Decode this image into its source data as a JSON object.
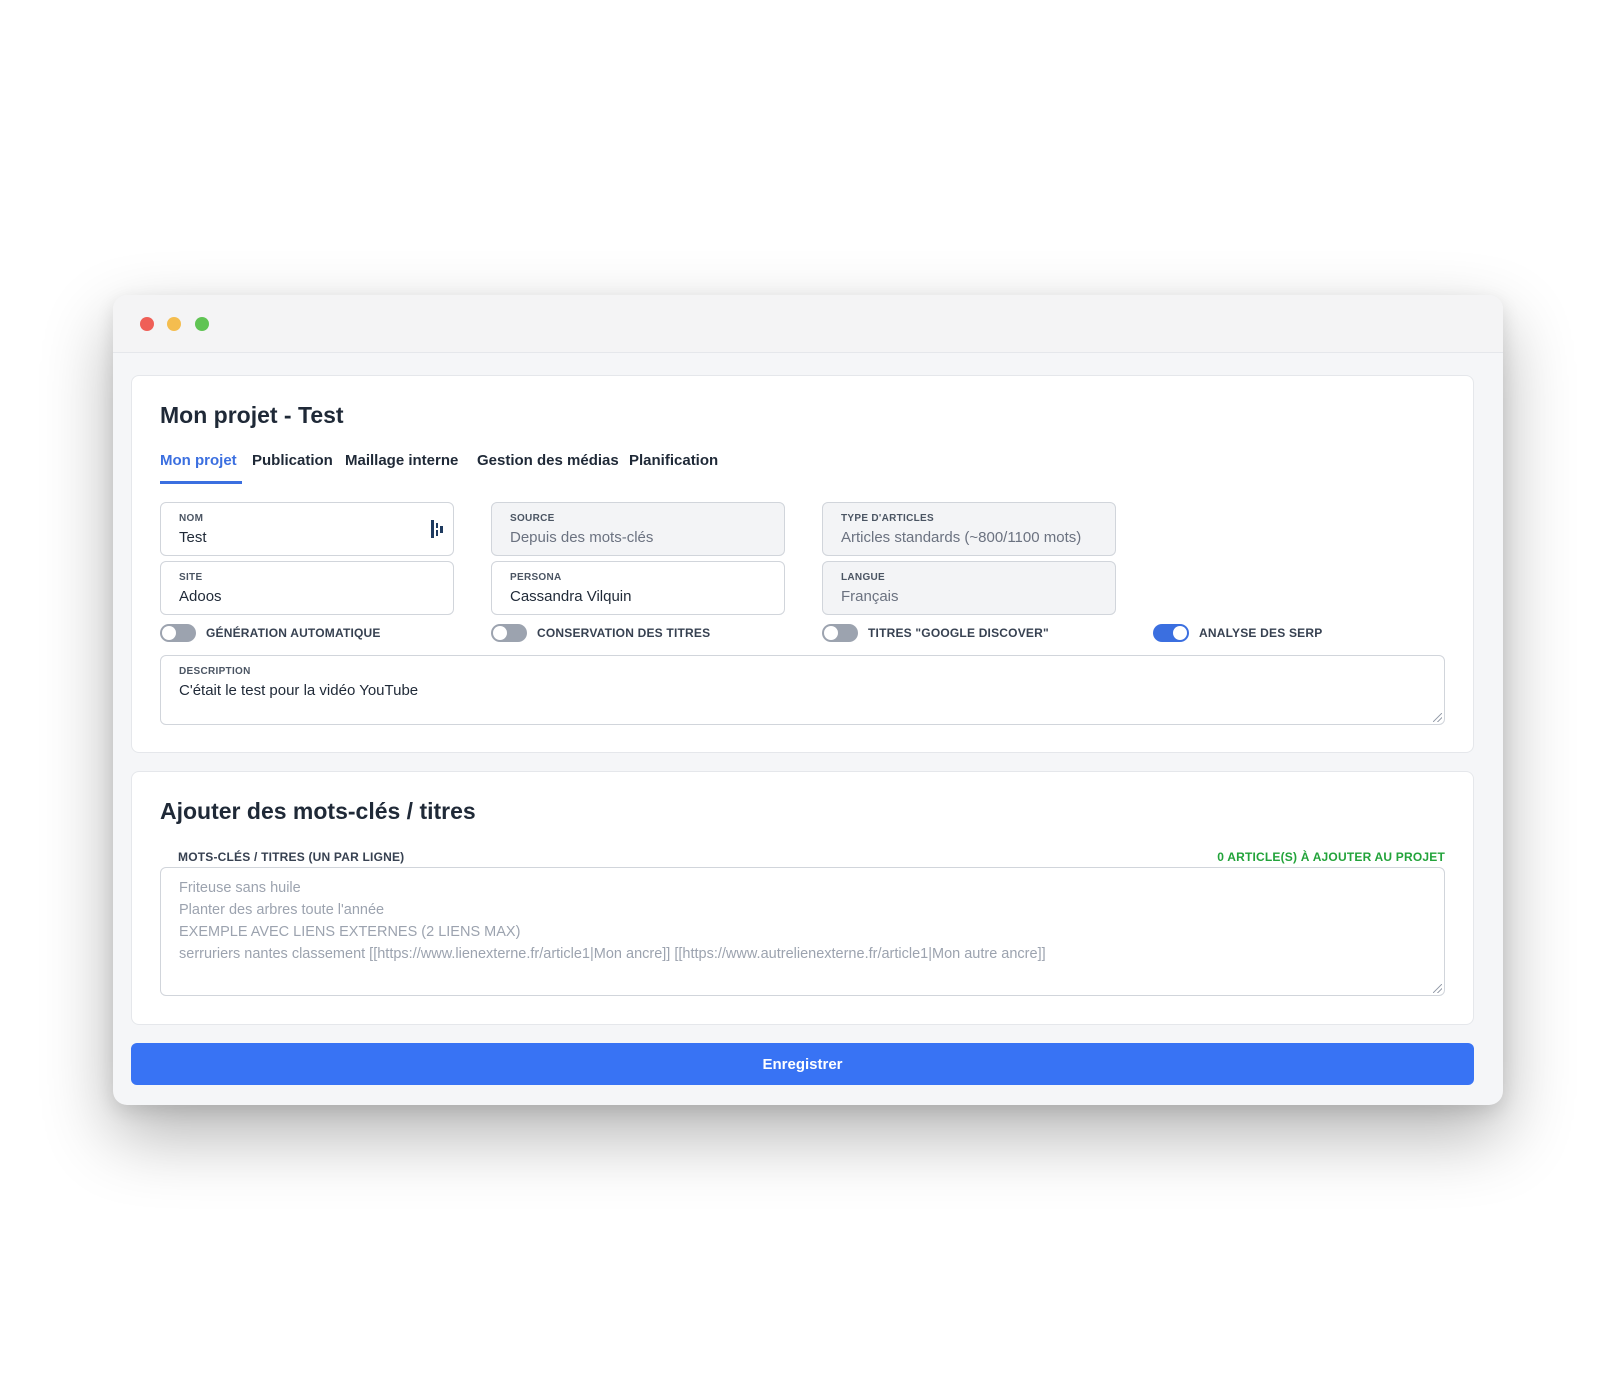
{
  "window": {
    "controls": [
      "close",
      "minimize",
      "maximize"
    ]
  },
  "project": {
    "title": "Mon projet - Test",
    "tabs": [
      {
        "label": "Mon projet",
        "active": true
      },
      {
        "label": "Publication",
        "active": false
      },
      {
        "label": "Maillage interne",
        "active": false
      },
      {
        "label": "Gestion des médias",
        "active": false
      },
      {
        "label": "Planification",
        "active": false
      }
    ],
    "fields": {
      "nom": {
        "label": "NOM",
        "value": "Test",
        "icon": "key-icon"
      },
      "source": {
        "label": "SOURCE",
        "value": "Depuis des mots-clés"
      },
      "type_articles": {
        "label": "TYPE D'ARTICLES",
        "value": "Articles standards (~800/1100 mots)"
      },
      "site": {
        "label": "SITE",
        "value": "Adoos"
      },
      "persona": {
        "label": "PERSONA",
        "value": "Cassandra Vilquin"
      },
      "langue": {
        "label": "LANGUE",
        "value": "Français"
      }
    },
    "toggles": [
      {
        "label": "GÉNÉRATION AUTOMATIQUE",
        "on": false
      },
      {
        "label": "CONSERVATION DES TITRES",
        "on": false
      },
      {
        "label": "TITRES \"GOOGLE DISCOVER\"",
        "on": false
      },
      {
        "label": "ANALYSE DES SERP",
        "on": true
      }
    ],
    "description": {
      "label": "DESCRIPTION",
      "value": "C'était le test pour la vidéo YouTube"
    }
  },
  "keywords": {
    "title": "Ajouter des mots-clés / titres",
    "field_label": "MOTS-CLÉS / TITRES (UN PAR LIGNE)",
    "count_label": "0 ARTICLE(S) À AJOUTER AU PROJET",
    "placeholder_lines": [
      "Friteuse sans huile",
      "Planter des arbres toute l'année",
      "EXEMPLE AVEC LIENS EXTERNES (2 LIENS MAX)",
      "serruriers nantes classement [[https://www.lienexterne.fr/article1|Mon ancre]] [[https://www.autrelienexterne.fr/article1|Mon autre ancre]]"
    ]
  },
  "actions": {
    "save_label": "Enregistrer"
  },
  "colors": {
    "accent": "#3b6fe0",
    "button": "#3873f4",
    "success": "#22a33a"
  }
}
